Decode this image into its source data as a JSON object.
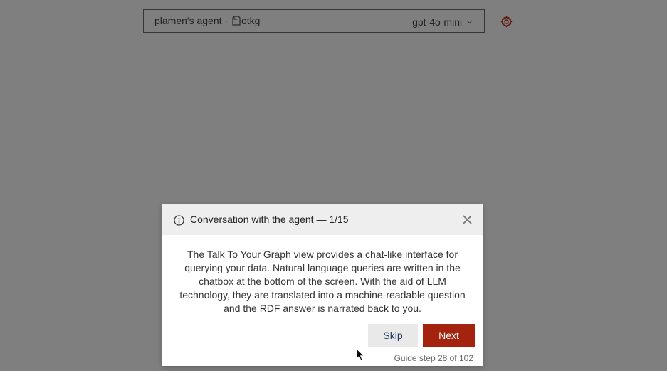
{
  "topbar": {
    "agent_name": "plamen's agent",
    "separator": "·",
    "repository": "otkg",
    "model": "gpt-4o-mini"
  },
  "icons": {
    "repository": "repository-icon",
    "model_dropdown": "chevron-down-icon",
    "settings": "gear-icon",
    "info": "info-icon",
    "close": "close-icon"
  },
  "guide": {
    "title": "Conversation with the agent — 1/15",
    "body": "The Talk To Your Graph view provides a chat-like interface for querying your data. Natural language queries are written in the chatbox at the bottom of the screen. With the aid of LLM technology, they are translated into a machine-readable question and the RDF answer is narrated back to you.",
    "skip_label": "Skip",
    "next_label": "Next",
    "step_counter": "Guide step 28 of 102"
  },
  "colors": {
    "accent": "#a4230e",
    "skip_text": "#213a63",
    "overlay": "rgba(0,0,0,0.5)"
  }
}
